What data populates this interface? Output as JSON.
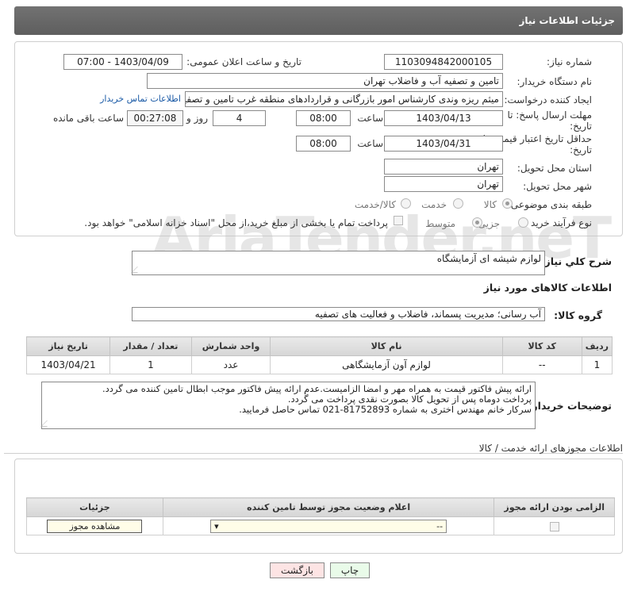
{
  "header": {
    "title": "جزئیات اطلاعات نیاز"
  },
  "form": {
    "need_number_label": "شماره نیاز:",
    "need_number": "1103094842000105",
    "announce_label": "تاریخ و ساعت اعلان عمومی:",
    "announce_value": "1403/04/09 - 07:00",
    "buyer_label": "نام دستگاه خریدار:",
    "buyer_value": "تامین و تصفیه آب و فاضلاب تهران",
    "creator_label": "ایجاد کننده درخواست:",
    "creator_value": "میثم ریزه وندی کارشناس امور بازرگانی و قراردادهای منطقه غرب تامین و تصفیه",
    "contact_link": "اطلاعات تماس خریدار",
    "deadline_label_1": "مهلت ارسال پاسخ: تا",
    "deadline_label_2": "تاریخ:",
    "deadline_date": "1403/04/13",
    "time_label": "ساعت",
    "deadline_time": "08:00",
    "days_value": "4",
    "days_label": "روز و",
    "remaining_time": "00:27:08",
    "remaining_label": "ساعت باقی مانده",
    "validity_label_1": "حداقل تاریخ اعتبار قیمت: تا",
    "validity_label_2": "تاریخ:",
    "validity_date": "1403/04/31",
    "validity_time": "08:00",
    "province_label": "استان محل تحویل:",
    "province_value": "تهران",
    "city_label": "شهر محل تحویل:",
    "city_value": "تهران",
    "category_label": "طبقه بندی موضوعی:",
    "category_options": [
      "کالا",
      "خدمت",
      "کالا/خدمت"
    ],
    "process_label": "نوع فرآیند خرید :",
    "process_options": [
      "جزیی",
      "متوسط"
    ],
    "payment_note": "پرداخت تمام یا بخشی از مبلغ خرید،از محل \"اسناد خزانه اسلامی\" خواهد بود."
  },
  "summary": {
    "label": "شرح کلي نياز:",
    "value": "لوازم شیشه ای آزمایشگاه"
  },
  "goods": {
    "section_title": "اطلاعات کالاهای مورد نیاز",
    "group_label": "گروه کالا:",
    "group_value": "آب رسانی؛ مدیریت پسماند، فاضلاب و فعالیت های تصفیه",
    "columns": [
      "ردیف",
      "کد کالا",
      "نام کالا",
      "واحد شمارش",
      "تعداد / مقدار",
      "تاریخ نیاز"
    ],
    "rows": [
      {
        "row": "1",
        "code": "--",
        "name": "لوازم آون آزمایشگاهی",
        "unit": "عدد",
        "qty": "1",
        "date": "1403/04/21"
      }
    ]
  },
  "buyer_notes": {
    "label": "توضیحات خریدار:",
    "line1": "ارائه پیش فاکتور قیمت به همراه مهر و امضا الزامیست.عدم ارائه پیش فاکتور موجب ابطال تامین کننده می گردد.",
    "line2": "پرداخت دوماه پس از تحویل کالا بصورت نقدی پرداخت می گردد.",
    "line3": "سرکار خانم مهندس اختری  به شماره 81752893-021 تماس حاصل فرمایید."
  },
  "permits": {
    "title": "اطلاعات مجوزهای ارائه خدمت / کالا",
    "columns": [
      "الزامی بودن ارائه مجوز",
      "اعلام وضعیت مجوز توسط تامین کننده",
      "جزئیات"
    ],
    "select_value": "--",
    "view_button": "مشاهده مجوز"
  },
  "buttons": {
    "print": "چاپ",
    "back": "بازگشت"
  },
  "watermark": "AriaTender.neT",
  "colors": {
    "header_bg": "#666666",
    "link": "#1a5aa6",
    "back_btn_bg": "#fde4e4",
    "print_btn_bg": "#e9fbe9"
  }
}
